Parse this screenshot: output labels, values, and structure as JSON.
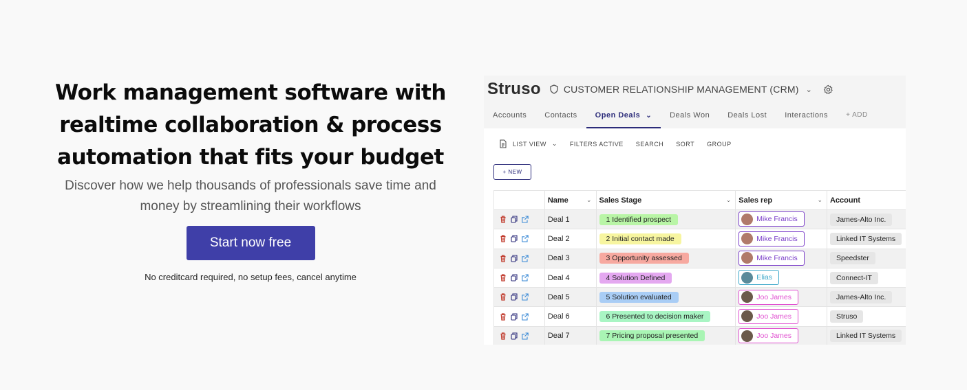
{
  "hero": {
    "headline_line1": "Work management software with",
    "headline_line2": "realtime collaboration & process",
    "headline_line3": "automation that fits your budget",
    "sub_line1": "Discover how we help thousands of professionals save time and",
    "sub_line2": "money by streamlining their workflows",
    "cta_label": "Start now free",
    "note": "No creditcard required, no setup fees, cancel anytime"
  },
  "app": {
    "brand": "Struso",
    "title": "CUSTOMER RELATIONSHIP MANAGEMENT (CRM)",
    "tabs": [
      "Accounts",
      "Contacts",
      "Open Deals",
      "Deals Won",
      "Deals Lost",
      "Interactions"
    ],
    "active_tab": "Open Deals",
    "add_tab_label": "+ ADD",
    "toolbar": {
      "list_view": "LIST VIEW",
      "filters": "FILTERS ACTIVE",
      "search": "SEARCH",
      "sort": "SORT",
      "group": "GROUP"
    },
    "new_button": "+ NEW",
    "columns": [
      "Name",
      "Sales Stage",
      "Sales rep",
      "Account"
    ],
    "rows": [
      {
        "name": "Deal 1",
        "stage": "1 Identified prospect",
        "stage_color": "#b9f5a6",
        "rep": "Mike Francis",
        "rep_color": "#7b3fc9",
        "avatar_color": "#b07a6a",
        "account": "James-Alto Inc."
      },
      {
        "name": "Deal 2",
        "stage": "2 Initial contact made",
        "stage_color": "#f7f5a0",
        "rep": "Mike Francis",
        "rep_color": "#7b3fc9",
        "avatar_color": "#b07a6a",
        "account": "Linked IT Systems"
      },
      {
        "name": "Deal 3",
        "stage": "3 Opportunity assessed",
        "stage_color": "#f7a9a0",
        "rep": "Mike Francis",
        "rep_color": "#7b3fc9",
        "avatar_color": "#b07a6a",
        "account": "Speedster"
      },
      {
        "name": "Deal 4",
        "stage": "4 Solution Defined",
        "stage_color": "#e4a8f0",
        "rep": "Elias",
        "rep_color": "#3aa7c9",
        "avatar_color": "#5a8a9a",
        "account": "Connect-IT"
      },
      {
        "name": "Deal 5",
        "stage": "5 Solution evaluated",
        "stage_color": "#a9cdf5",
        "rep": "Joo James",
        "rep_color": "#e04fd0",
        "avatar_color": "#6b5a4a",
        "account": "James-Alto Inc."
      },
      {
        "name": "Deal 6",
        "stage": "6 Presented to decision maker",
        "stage_color": "#a9f5c4",
        "rep": "Joo James",
        "rep_color": "#e04fd0",
        "avatar_color": "#6b5a4a",
        "account": "Struso"
      },
      {
        "name": "Deal 7",
        "stage": "7 Pricing proposal presented",
        "stage_color": "#a9f5b4",
        "rep": "Joo James",
        "rep_color": "#e04fd0",
        "avatar_color": "#6b5a4a",
        "account": "Linked IT Systems"
      }
    ]
  },
  "colors": {
    "cta": "#3f3fa8",
    "accent": "#2c2c7a",
    "delete_icon": "#c0392b",
    "copy_icon": "#2c2c7a",
    "open_icon": "#3a8ad6"
  }
}
